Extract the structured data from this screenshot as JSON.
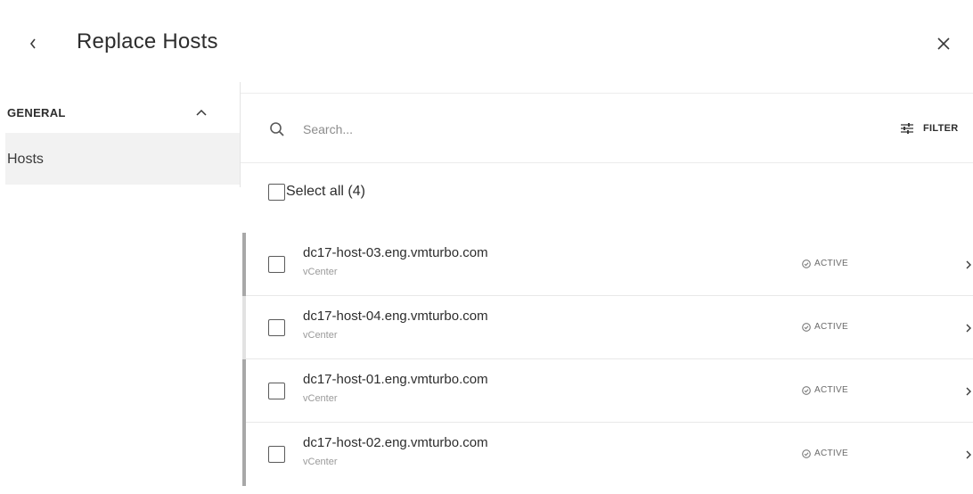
{
  "header": {
    "title": "Replace Hosts"
  },
  "sidebar": {
    "section_label": "GENERAL",
    "items": [
      {
        "label": "Hosts"
      }
    ]
  },
  "search": {
    "placeholder": "Search...",
    "filter_label": "FILTER"
  },
  "select_all": {
    "label": "Select all (4)"
  },
  "hosts": [
    {
      "name": "dc17-host-03.eng.vmturbo.com",
      "source": "vCenter",
      "status": "ACTIVE"
    },
    {
      "name": "dc17-host-04.eng.vmturbo.com",
      "source": "vCenter",
      "status": "ACTIVE"
    },
    {
      "name": "dc17-host-01.eng.vmturbo.com",
      "source": "vCenter",
      "status": "ACTIVE"
    },
    {
      "name": "dc17-host-02.eng.vmturbo.com",
      "source": "vCenter",
      "status": "ACTIVE"
    }
  ],
  "colors": {
    "row_accent_dark": "#a8a8a8",
    "row_accent_light": "#e2e2e2",
    "nav_selected_bg": "#f2f2f2"
  },
  "icons": {
    "back": "chevron-left-icon",
    "close": "close-icon",
    "collapse": "chevron-up-icon",
    "search": "search-icon",
    "filter": "sliders-icon",
    "status": "check-circle-icon",
    "row_open": "chevron-right-icon"
  }
}
